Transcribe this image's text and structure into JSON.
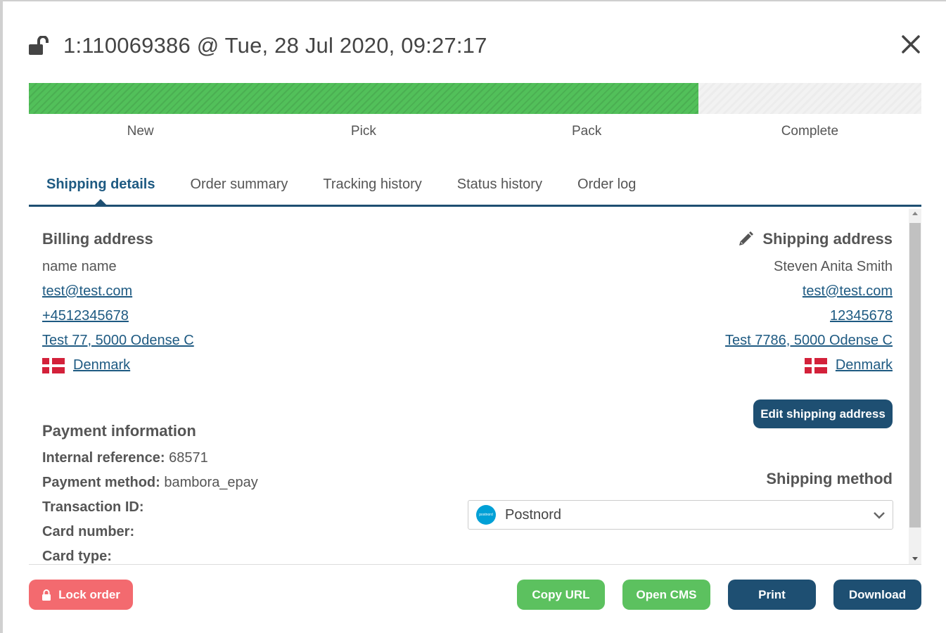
{
  "header": {
    "title": "1:110069386 @ Tue, 28 Jul 2020, 09:27:17",
    "lock_icon": "unlocked-padlock-icon",
    "close_icon": "close-icon"
  },
  "progress": {
    "fraction": 0.75,
    "fill_color": "#52c05a",
    "steps": [
      "New",
      "Pick",
      "Pack",
      "Complete"
    ]
  },
  "tabs": [
    "Shipping details",
    "Order summary",
    "Tracking history",
    "Status history",
    "Order log"
  ],
  "billing": {
    "title": "Billing address",
    "name": "name name",
    "email": "test@test.com",
    "phone": "+4512345678",
    "address": "Test 77, 5000 Odense C",
    "country": "Denmark"
  },
  "shipping": {
    "title": "Shipping address",
    "name": "Steven Anita Smith",
    "email": "test@test.com",
    "phone": "12345678",
    "address": "Test 7786, 5000 Odense C",
    "country": "Denmark",
    "edit_button": "Edit shipping address"
  },
  "payment": {
    "title": "Payment information",
    "internal_reference_label": "Internal reference:",
    "internal_reference_value": "68571",
    "payment_method_label": "Payment method:",
    "payment_method_value": "bambora_epay",
    "transaction_id_label": "Transaction ID:",
    "card_number_label": "Card number:",
    "card_type_label": "Card type:"
  },
  "shipping_method": {
    "title": "Shipping method",
    "selected": "Postnord",
    "logo_text": "postnord"
  },
  "footer": {
    "lock": "Lock order",
    "copy_url": "Copy URL",
    "open_cms": "Open CMS",
    "print": "Print",
    "download": "Download"
  },
  "colors": {
    "primary": "#1e4f72",
    "success": "#5cc15f",
    "danger": "#f36a6f",
    "link": "#1e5a82"
  }
}
